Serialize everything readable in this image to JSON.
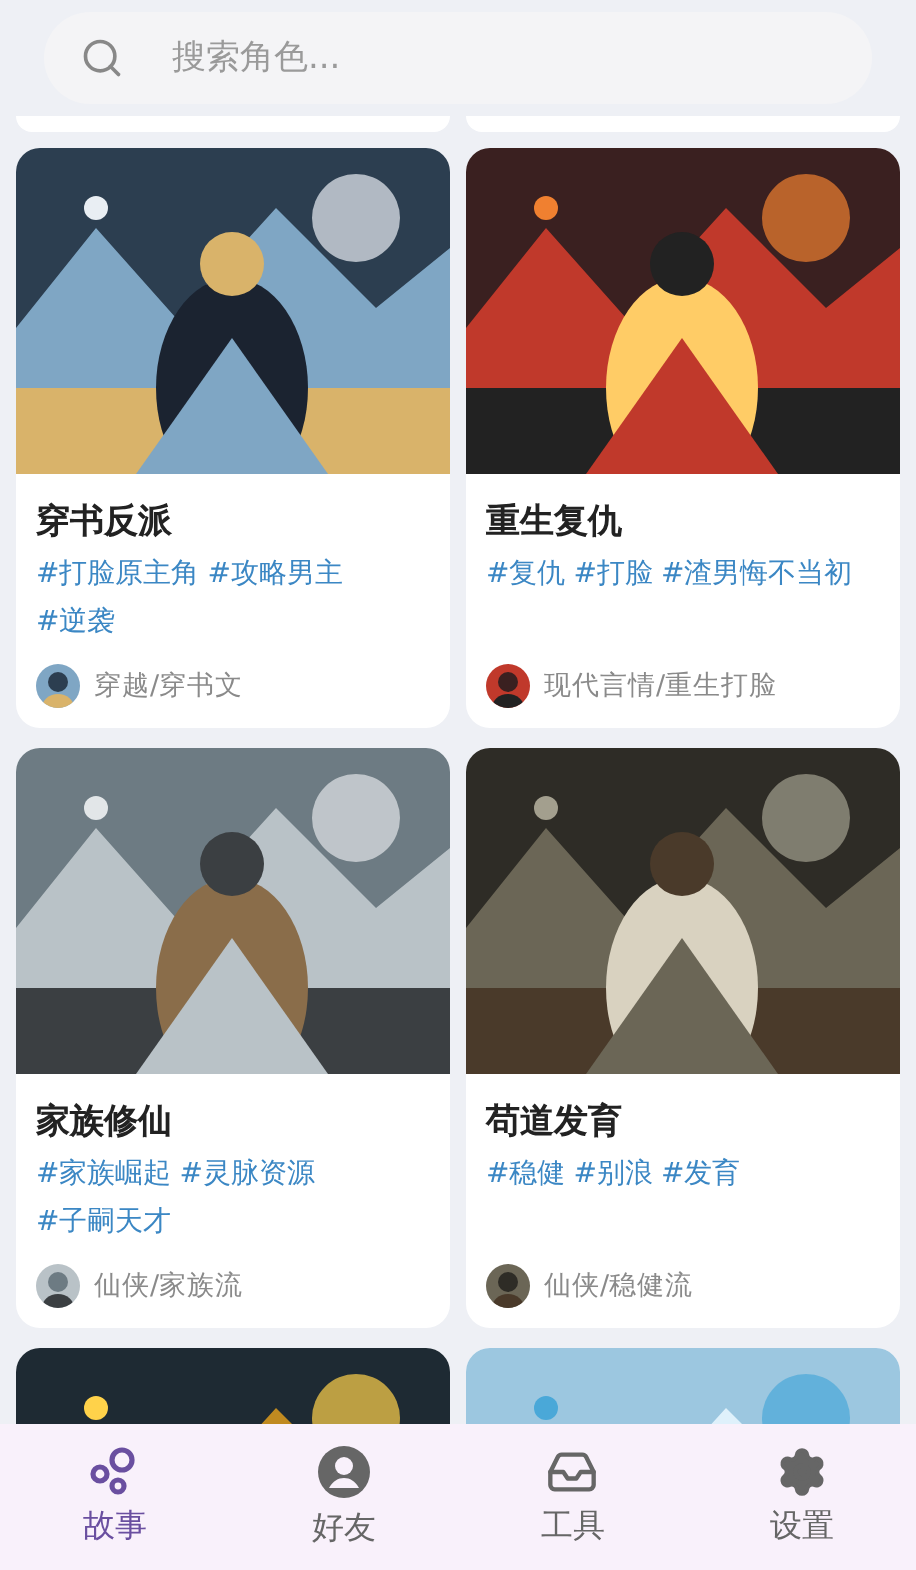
{
  "search": {
    "placeholder": "搜索角色..."
  },
  "cards": [
    {
      "kind": "story",
      "title": "穿书反派",
      "tags": [
        "#打脸原主角",
        "#攻略男主",
        "#逆袭"
      ],
      "category": "穿越/穿书文"
    },
    {
      "kind": "story",
      "title": "重生复仇",
      "tags": [
        "#复仇",
        "#打脸",
        "#渣男悔不当初"
      ],
      "category": "现代言情/重生打脸"
    },
    {
      "kind": "story",
      "title": "家族修仙",
      "tags": [
        "#家族崛起",
        "#灵脉资源",
        "#子嗣天才"
      ],
      "category": "仙侠/家族流"
    },
    {
      "kind": "story",
      "title": "苟道发育",
      "tags": [
        "#稳健",
        "#别浪",
        "#发育"
      ],
      "category": "仙侠/稳健流"
    },
    {
      "kind": "picture"
    },
    {
      "kind": "picture"
    }
  ],
  "nav": [
    {
      "label": "故事",
      "selected": true
    },
    {
      "label": "好友",
      "selected": false
    },
    {
      "label": "工具",
      "selected": false
    },
    {
      "label": "设置",
      "selected": false
    }
  ]
}
